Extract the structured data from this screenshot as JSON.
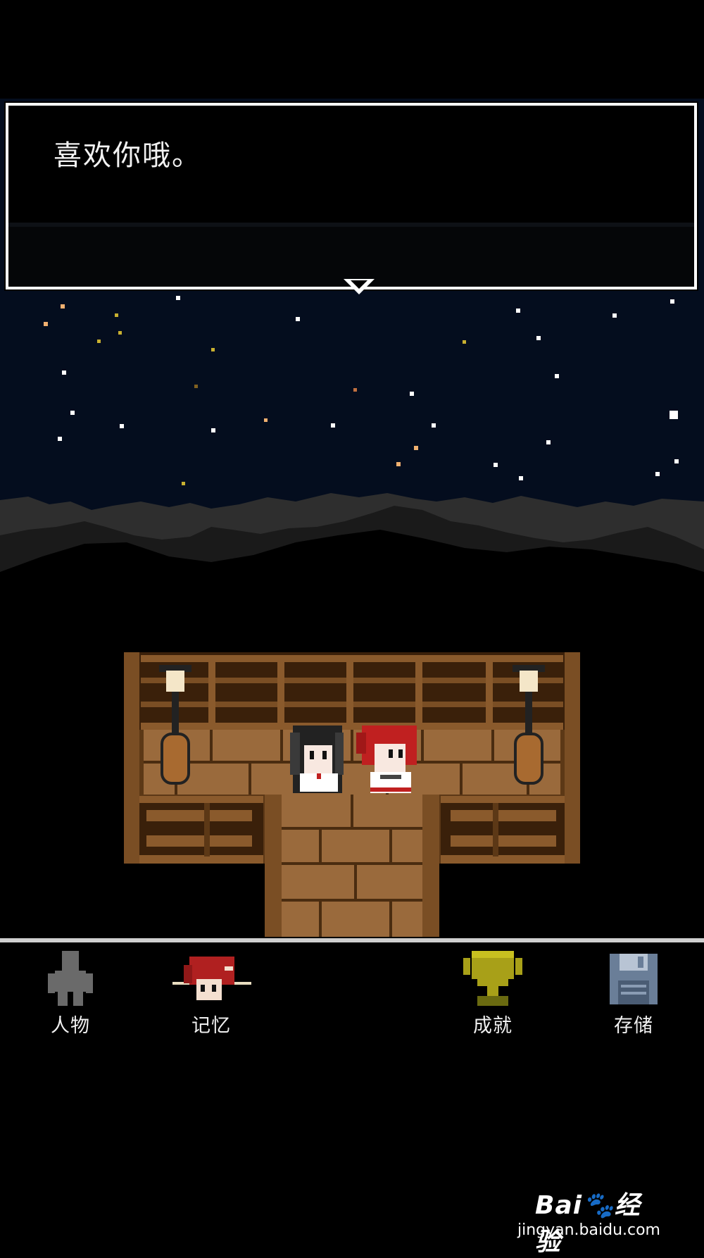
{
  "dialog": {
    "text": "喜欢你哦。"
  },
  "menu": {
    "items": [
      {
        "label": "人物",
        "icon": "person-icon"
      },
      {
        "label": "记忆",
        "icon": "memory-portrait-icon"
      },
      {
        "label": "成就",
        "icon": "trophy-icon"
      },
      {
        "label": "存储",
        "icon": "save-disk-icon"
      }
    ]
  },
  "watermark": {
    "logo": "Bai🐾经验",
    "url": "jingyan.baidu.com"
  },
  "colors": {
    "sky": "#040d1e",
    "wood": "#8a5a2c",
    "floor": "#9a6a3c",
    "divider": "#cfcfcf"
  }
}
